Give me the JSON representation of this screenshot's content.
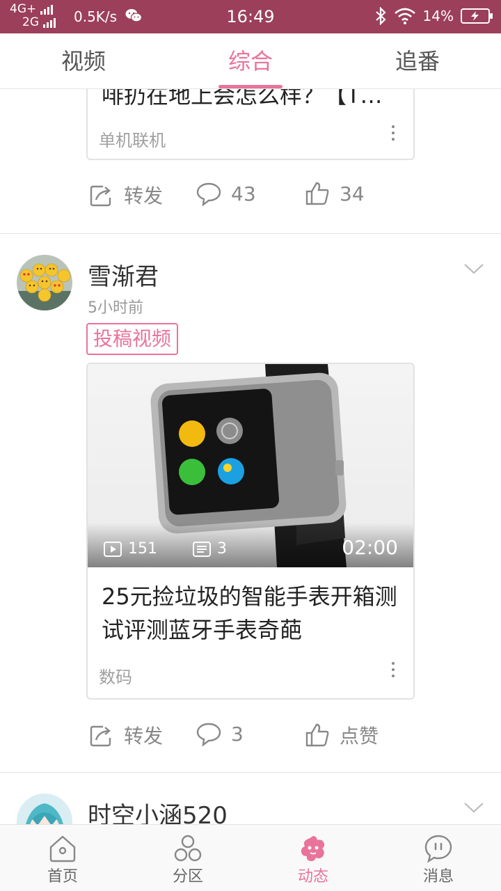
{
  "status_bar": {
    "net_top": "4G+",
    "net_bottom": "2G",
    "speed": "0.5K/s",
    "time": "16:49",
    "battery": "14%"
  },
  "top_tabs": [
    {
      "label": "视频",
      "active": false
    },
    {
      "label": "综合",
      "active": true
    },
    {
      "label": "追番",
      "active": false
    }
  ],
  "feed": {
    "prev_post": {
      "title_fragment": "啡扔在地上会怎么样？【T…",
      "category": "单机联机",
      "repost_label": "转发",
      "comment_count": "43",
      "like_count": "34"
    },
    "post": {
      "username": "雪渐君",
      "time": "5小时前",
      "tag": "投稿视频",
      "video": {
        "views": "151",
        "danmaku": "3",
        "duration": "02:00",
        "title": "25元捡垃圾的智能手表开箱测试评测蓝牙手表奇葩",
        "category": "数码"
      },
      "repost_label": "转发",
      "comment_count": "3",
      "like_label": "点赞"
    },
    "next_post": {
      "username": "时空小涵520"
    }
  },
  "bottom_nav": [
    {
      "label": "首页",
      "icon": "home-icon",
      "active": false
    },
    {
      "label": "分区",
      "icon": "category-icon",
      "active": false
    },
    {
      "label": "动态",
      "icon": "dynamic-icon",
      "active": true
    },
    {
      "label": "消息",
      "icon": "message-icon",
      "active": false
    }
  ],
  "colors": {
    "accent": "#e9739a",
    "status_bar": "#9c3f5a"
  }
}
